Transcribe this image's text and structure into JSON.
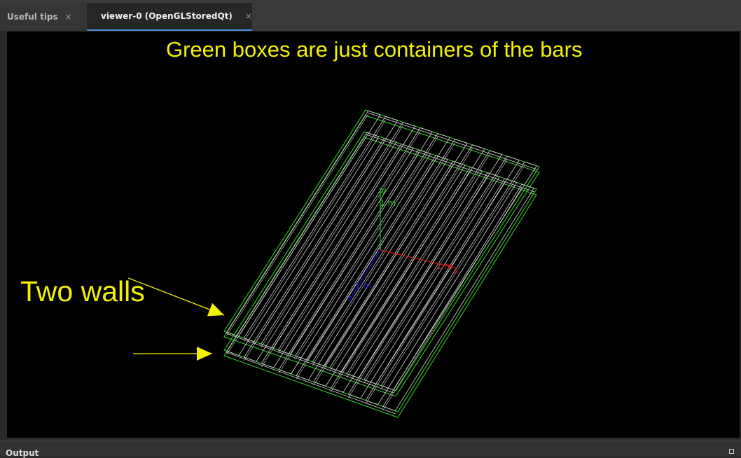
{
  "tabs": [
    {
      "label": "Useful tips",
      "close": "×"
    },
    {
      "label": "viewer-0 (OpenGLStoredQt)",
      "close": "×"
    }
  ],
  "viewer": {
    "background": "#000000",
    "annotations": {
      "top": "Green boxes are just containers of the bars",
      "walls": "Two walls"
    },
    "axes": {
      "y_label": "y",
      "y_length": "1 m",
      "x_label": "x",
      "x_length": "1 m",
      "z_label": "z",
      "z_length": "1 m"
    },
    "colors": {
      "container": "#39d12f",
      "bars": "#d8d8d8",
      "annotation": "#f2f200",
      "axis_x": "#d01818",
      "axis_y": "#17c617",
      "axis_z": "#1a1ad6"
    }
  },
  "output_panel": {
    "label": "Output"
  }
}
